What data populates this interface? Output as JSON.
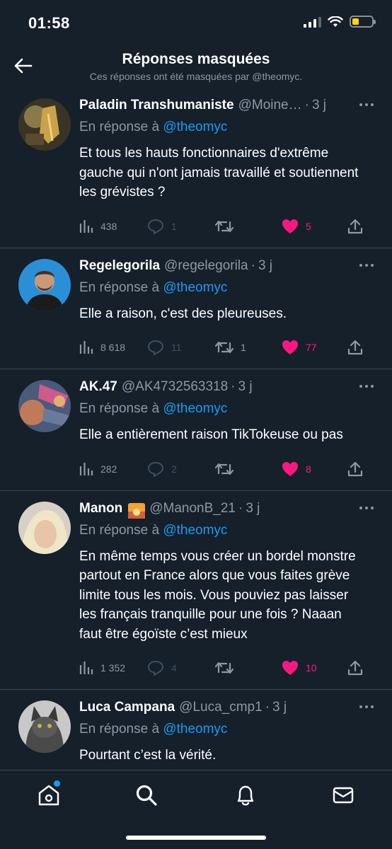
{
  "status_bar": {
    "time": "01:58"
  },
  "header": {
    "title": "Réponses masquées",
    "subtitle": "Ces réponses ont été masquées par @theomyc."
  },
  "reply_prefix": "En réponse à",
  "reply_mention": "@theomyc",
  "tweets": [
    {
      "name": "Paladin Transhumaniste",
      "handle": "@Moine…",
      "age": "3 j",
      "text": "Et tous les hauts fonctionnaires d'extrême gauche qui n'ont jamais travaillé et soutiennent les grévistes ?",
      "views": "438",
      "replies": "1",
      "retweets": "",
      "likes": "5",
      "avatar_colors": [
        "#8a7a4a",
        "#c9a24a"
      ]
    },
    {
      "name": "Regelegorila",
      "handle": "@regelegorila",
      "age": "3 j",
      "text": "Elle a raison, c'est des pleureuses.",
      "views": "8 618",
      "replies": "11",
      "retweets": "1",
      "likes": "77",
      "avatar_colors": [
        "#2b8fd8",
        "#6a4a3a"
      ]
    },
    {
      "name": "AK.47",
      "handle": "@AK4732563318",
      "age": "3 j",
      "text": "Elle a entièrement raison TikTokeuse ou pas",
      "views": "282",
      "replies": "2",
      "retweets": "",
      "likes": "8",
      "avatar_colors": [
        "#6a7a9a",
        "#d05a8a"
      ]
    },
    {
      "name": "Manon",
      "handle": "@ManonB_21",
      "age": "3 j",
      "text": "En même temps vous créer un bordel monstre partout en France alors que vous faites grève limite tous les mois. Vous pouviez pas laisser les français tranquille pour une fois ? Naaan faut être égoïste c’est mieux",
      "views": "1 352",
      "replies": "4",
      "retweets": "",
      "likes": "10",
      "avatar_colors": [
        "#c8c0b8",
        "#e8d8c8"
      ]
    },
    {
      "name": "Luca Campana",
      "handle": "@Luca_cmp1",
      "age": "3 j",
      "text": "Pourtant c’est la vérité.",
      "views": "",
      "replies": "",
      "retweets": "",
      "likes": "",
      "avatar_colors": [
        "#9a9a9a",
        "#3a3a3a"
      ]
    }
  ],
  "colors": {
    "background": "#15202b",
    "accent": "#1d9bf0",
    "like": "#f91880",
    "muted": "#8b98a5",
    "divider": "#38444d"
  }
}
